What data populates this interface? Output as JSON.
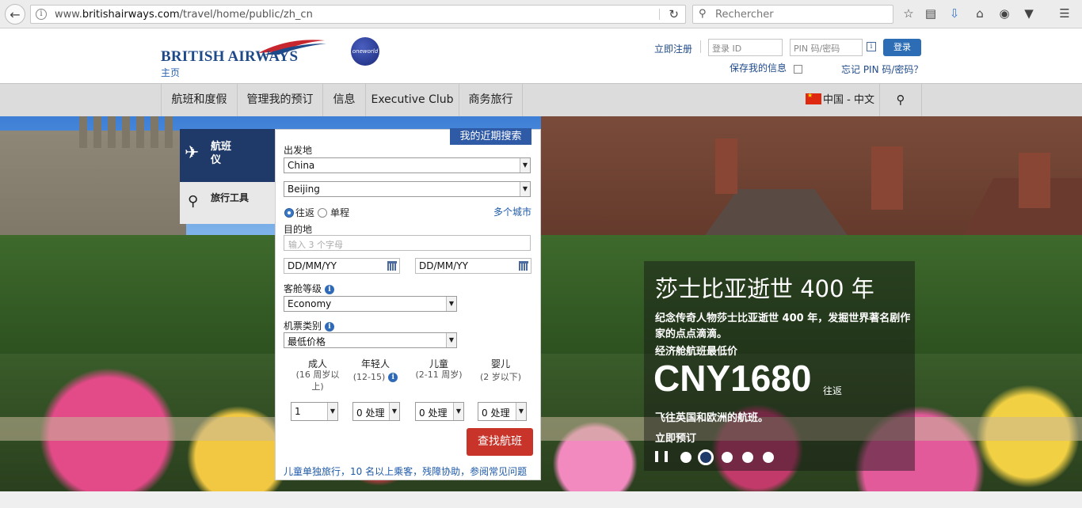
{
  "browser": {
    "url_prefix": "www.",
    "url_domain": "britishairways.com",
    "url_path": "/travel/home/public/zh_cn",
    "search_placeholder": "Rechercher"
  },
  "header": {
    "logo_text": "BRITISH AIRWAYS",
    "home_link": "主页",
    "oneworld_label": "oneworld",
    "register_link": "立即注册",
    "login_id_placeholder": "登录 ID",
    "pin_placeholder": "PIN 码/密码",
    "login_button": "登录",
    "remember_label": "保存我的信息",
    "forgot_link": "忘记 PIN 码/密码？"
  },
  "nav": {
    "items": [
      "航班和度假",
      "管理我的预订",
      "信息",
      "Executive Club",
      "商务旅行"
    ],
    "language": "中国 - 中文"
  },
  "booking": {
    "tab_flight": "航班仪",
    "tab_flight_line1": "航班",
    "tab_flight_line2": "仪",
    "tab_tools": "旅行工具",
    "recent_search": "我的近期搜索",
    "from_label": "出发地",
    "from_country": "China",
    "from_city": "Beijing",
    "round_trip": "往返",
    "one_way": "单程",
    "multi_city": "多个城市",
    "to_label": "目的地",
    "to_placeholder": "输入 3 个字母",
    "depart_date": "DD/MM/YY",
    "return_date": "DD/MM/YY",
    "cabin_label": "客舱等级",
    "cabin_value": "Economy",
    "fare_label": "机票类别",
    "fare_value": "最低价格",
    "pax": [
      {
        "title": "成人",
        "sub1": "(16 周岁以",
        "sub2": "上)",
        "value": "1"
      },
      {
        "title": "年轻人",
        "sub1": "(12-15)",
        "sub2": "",
        "value": "0 处理"
      },
      {
        "title": "儿童",
        "sub1": "(2-11 周岁)",
        "sub2": "",
        "value": "0 处理"
      },
      {
        "title": "婴儿",
        "sub1": "(2 岁以下)",
        "sub2": "",
        "value": "0 处理"
      }
    ],
    "find_button": "查找航班",
    "footer_links": "儿童单独旅行，10 名以上乘客，残障协助，参阅常见问题"
  },
  "promo": {
    "title": "莎士比亚逝世 400 年",
    "description": "纪念传奇人物莎士比亚逝世 400 年，发掘世界著名剧作家的点点滴滴。",
    "sub": "经济舱航班最低价",
    "price": "CNY1680",
    "trip_type": "往返",
    "note": "飞往英国和欧洲的航班。",
    "cta": "立即预订",
    "slide_count": 5,
    "active_slide": 2
  },
  "colors": {
    "brand_navy": "#1f3a68",
    "brand_blue": "#2c6db5",
    "cta_red": "#c8342a"
  }
}
